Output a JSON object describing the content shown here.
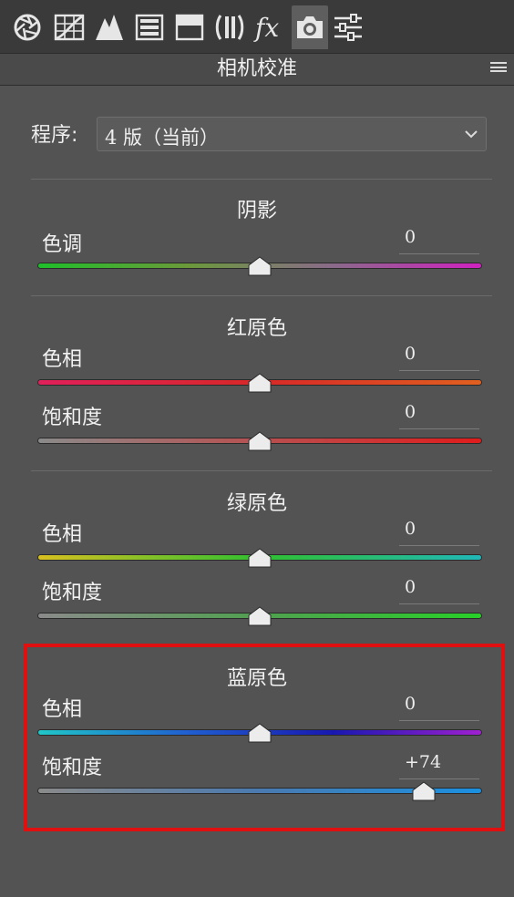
{
  "toolbar": {
    "tools": [
      {
        "icon": "aperture-icon"
      },
      {
        "icon": "tone-curve-icon"
      },
      {
        "icon": "detail-icon"
      },
      {
        "icon": "hsl-icon"
      },
      {
        "icon": "split-toning-icon"
      },
      {
        "icon": "lens-corrections-icon"
      },
      {
        "icon": "effects-icon",
        "text": "fx"
      },
      {
        "icon": "camera-calibration-icon",
        "active": true
      },
      {
        "icon": "presets-icon"
      }
    ]
  },
  "panel": {
    "title": "相机校准",
    "menu_icon": "menu-icon"
  },
  "program": {
    "label": "程序:",
    "value": "4 版（当前）"
  },
  "shadows": {
    "title": "阴影",
    "tint": {
      "label": "色调",
      "value": "0",
      "position": 0.5,
      "colors": [
        "#1fbf2a",
        "#6a9a3a",
        "#8a6a8a",
        "#d022c0"
      ]
    }
  },
  "red_primary": {
    "title": "红原色",
    "hue": {
      "label": "色相",
      "value": "0",
      "position": 0.5,
      "colors": [
        "#e0205a",
        "#d82828",
        "#e06020"
      ]
    },
    "saturation": {
      "label": "饱和度",
      "value": "0",
      "position": 0.5,
      "colors": [
        "#8a8a8a",
        "#b85050",
        "#e01c1c"
      ]
    }
  },
  "green_primary": {
    "title": "绿原色",
    "hue": {
      "label": "色相",
      "value": "0",
      "position": 0.5,
      "colors": [
        "#d8c020",
        "#30c030",
        "#20b8b8"
      ]
    },
    "saturation": {
      "label": "饱和度",
      "value": "0",
      "position": 0.5,
      "colors": [
        "#8a8a8a",
        "#50a050",
        "#28d028"
      ]
    }
  },
  "blue_primary": {
    "title": "蓝原色",
    "hue": {
      "label": "色相",
      "value": "0",
      "position": 0.5,
      "colors": [
        "#20c8c8",
        "#2060d0",
        "#1818b0",
        "#a020d0"
      ]
    },
    "saturation": {
      "label": "饱和度",
      "value": "+74",
      "position": 0.87,
      "colors": [
        "#8a8a8a",
        "#4a7ab0",
        "#1a90e0"
      ]
    }
  },
  "highlight_color": "#e01010"
}
